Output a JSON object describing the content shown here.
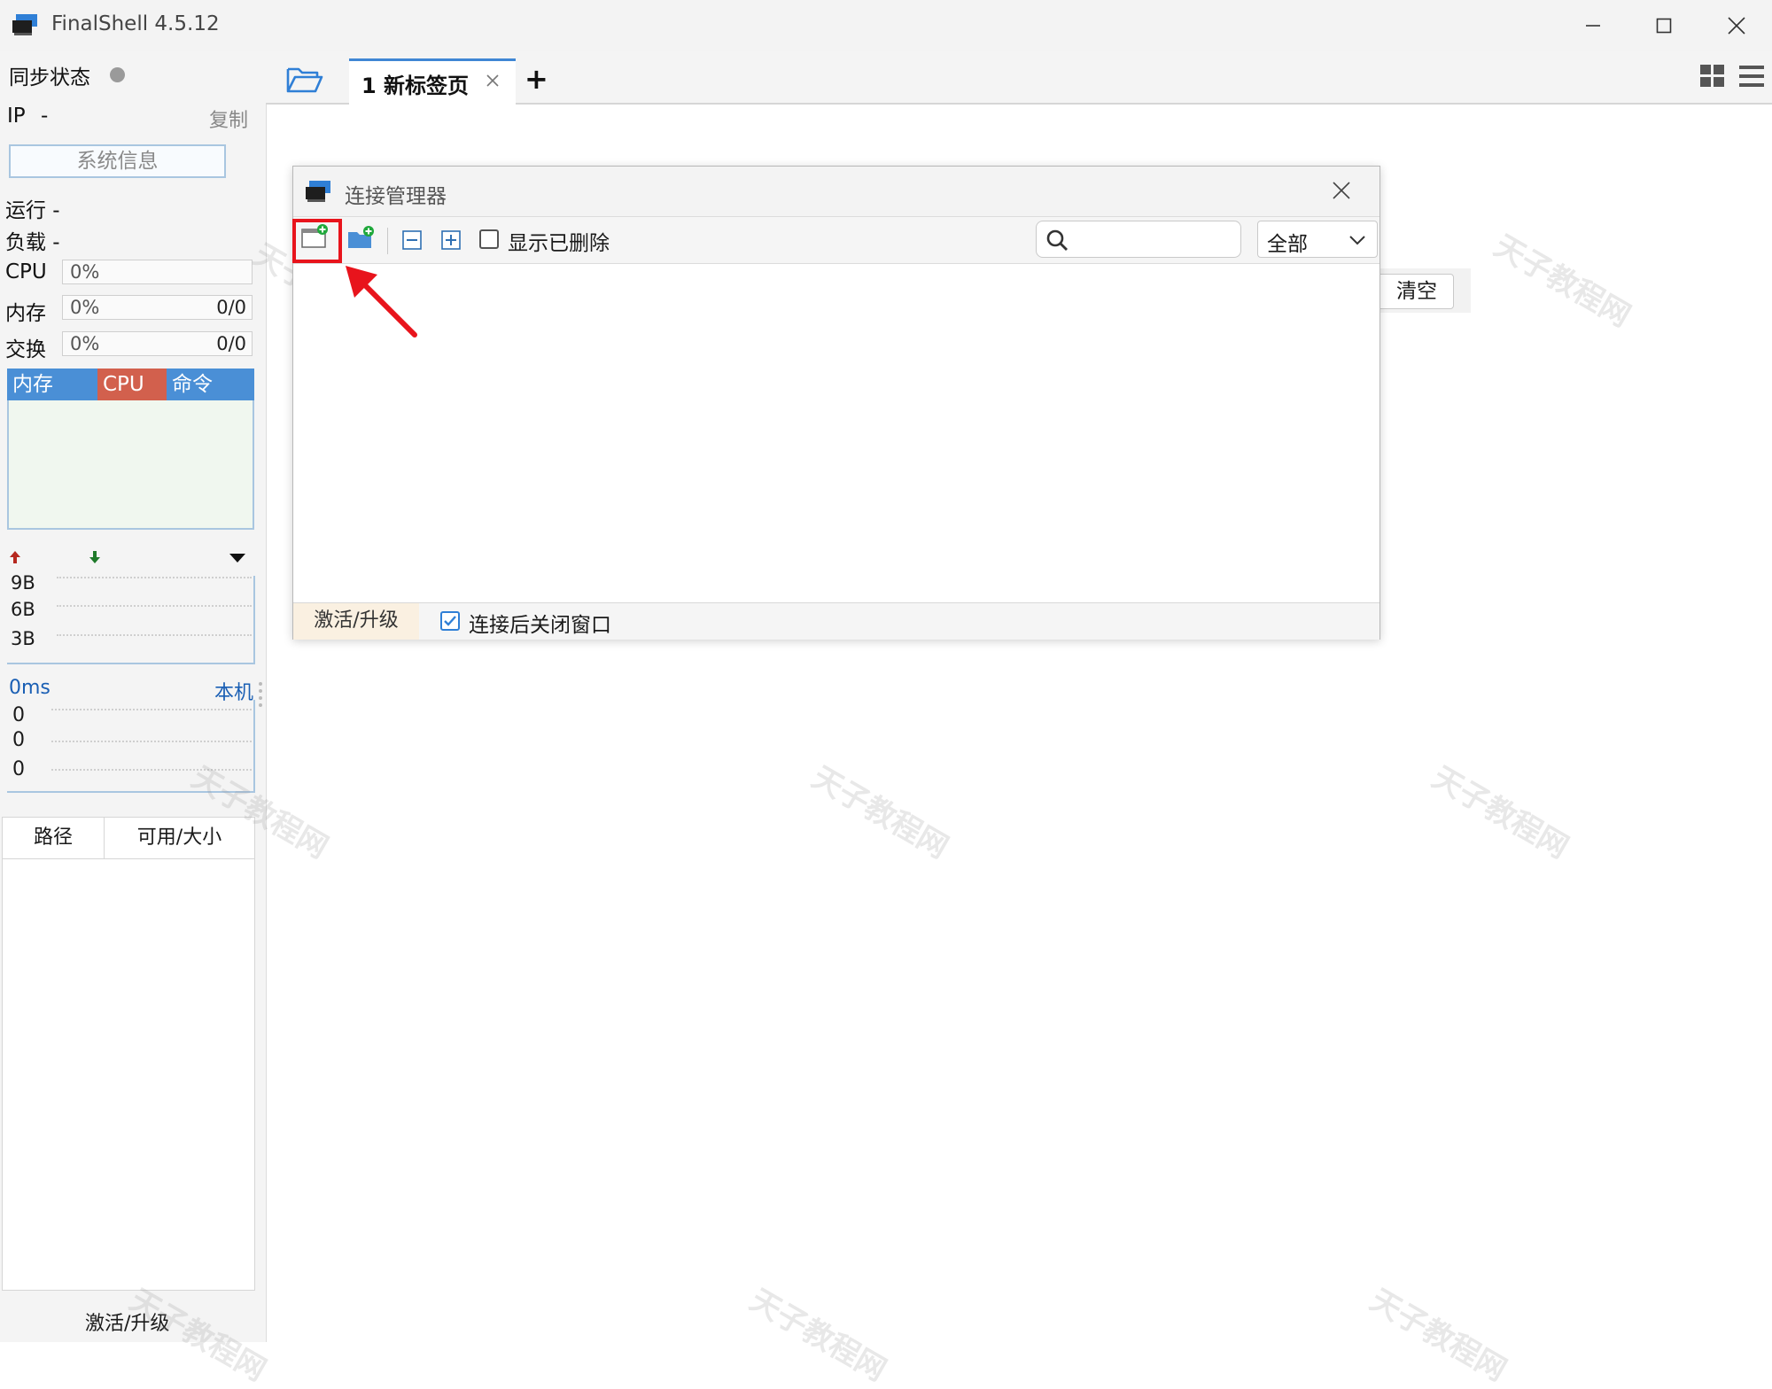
{
  "window": {
    "title": "FinalShell 4.5.12",
    "controls": [
      "minimize",
      "maximize",
      "close"
    ]
  },
  "left_panel": {
    "sync_label": "同步状态",
    "ip_label": "IP",
    "ip_value": "-",
    "copy_label": "复制",
    "sysinfo_button": "系统信息",
    "run_label": "运行 -",
    "load_label": "负载 -",
    "cpu": {
      "label": "CPU",
      "percent": "0%"
    },
    "mem": {
      "label": "内存",
      "percent": "0%",
      "ratio": "0/0"
    },
    "swap": {
      "label": "交换",
      "percent": "0%",
      "ratio": "0/0"
    },
    "chart_tabs": [
      "内存",
      "CPU",
      "命令"
    ],
    "net_labels": [
      "9B",
      "6B",
      "3B"
    ],
    "ping_label": "0ms",
    "host_label": "本机",
    "ping_values": [
      "0",
      "0",
      "0"
    ],
    "disk_columns": [
      "路径",
      "可用/大小"
    ],
    "activate_label": "激活/升级"
  },
  "tabs": {
    "tab1_label": "1 新标签页",
    "add_label": "+"
  },
  "background": {
    "clear_button": "清空"
  },
  "dialog": {
    "title": "连接管理器",
    "show_deleted_label": "显示已删除",
    "search_placeholder": "",
    "filter_value": "全部",
    "activate_label": "激活/升级",
    "close_after_connect_label": "连接后关闭窗口",
    "close_after_connect_checked": true
  },
  "watermark_text": "天子教程网",
  "colors": {
    "accent_blue": "#3f86d4",
    "chart_tab_mem": "#4a8fd6",
    "chart_tab_cpu": "#d2604d",
    "chart_tab_cmd": "#4a8fd6",
    "highlight_red": "#e8141c"
  }
}
